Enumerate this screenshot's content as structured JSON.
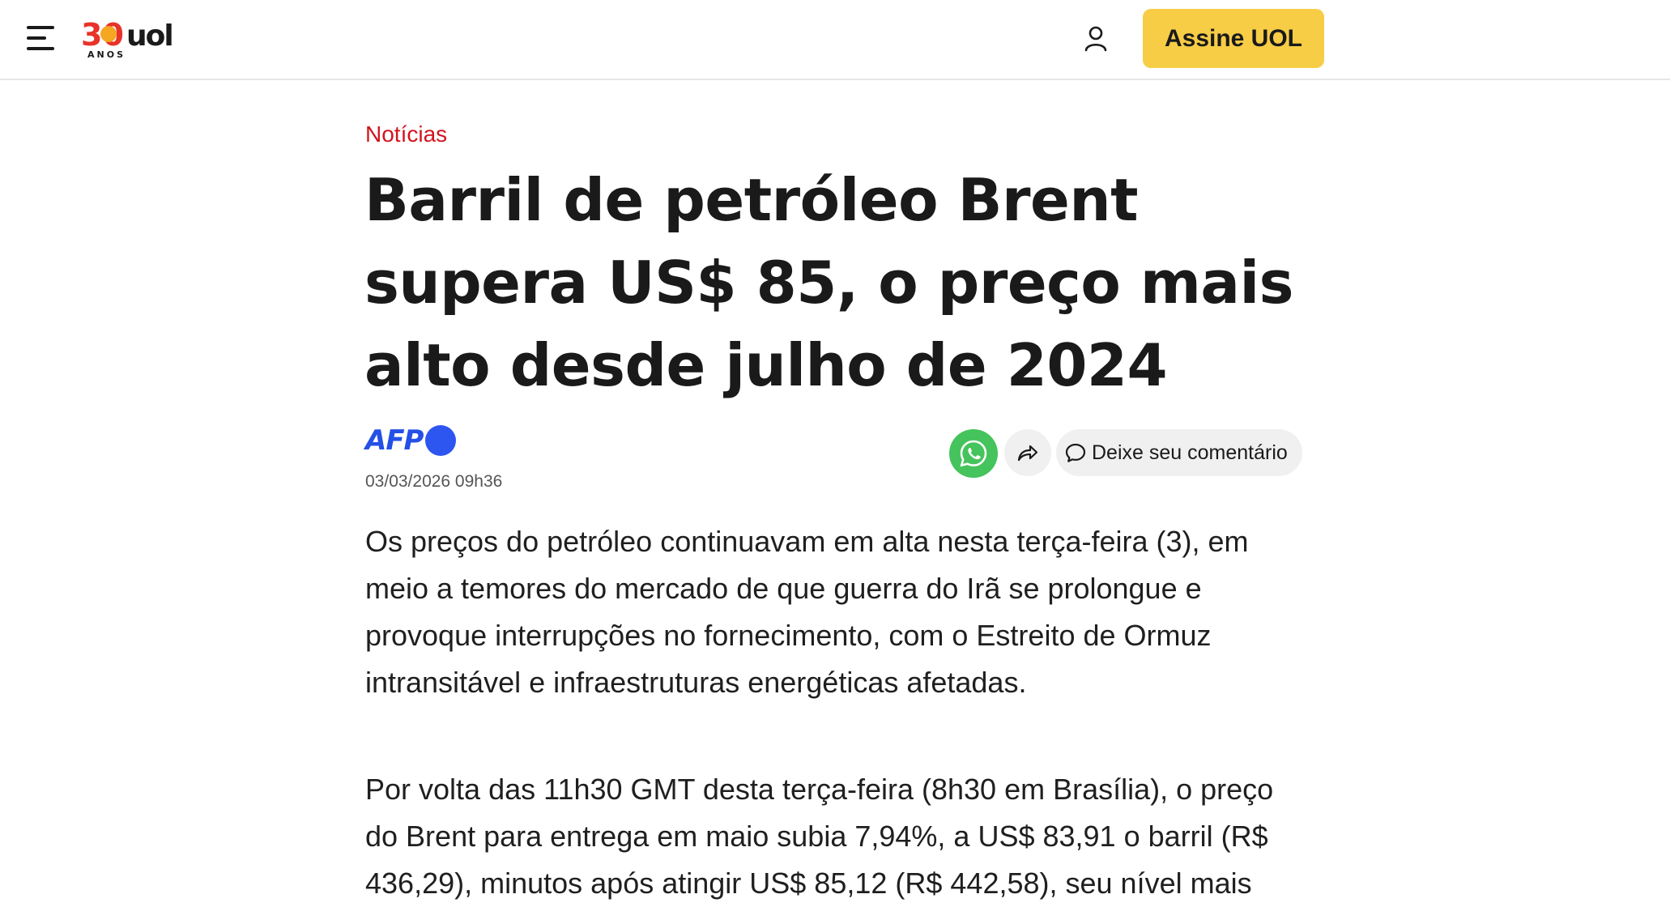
{
  "header": {
    "menu_icon": "hamburger-menu-icon",
    "logo_anos": "ANOS",
    "logo_number": "30",
    "logo_brand": "uol",
    "user_icon": "user-icon",
    "subscribe_label": "Assine UOL",
    "colors": {
      "subscribe_bg": "#f7cd46",
      "logo_red": "#e8322a"
    }
  },
  "article": {
    "category": "Notícias",
    "headline": "Barril de petróleo Brent supera US$ 85, o preço mais alto desde julho de 2024",
    "source": "AFP",
    "date": "03/03/2026 09h36",
    "share": {
      "whatsapp_icon": "whatsapp-icon",
      "share_icon": "share-arrow-icon",
      "comment_icon": "comment-bubble-icon",
      "comment_label": "Deixe seu comentário"
    },
    "paragraphs": [
      "Os preços do petróleo continuavam em alta nesta terça-feira (3), em meio a temores do mercado de que guerra do Irã se prolongue e provoque interrupções no fornecimento, com o Estreito de Ormuz intransitável e infraestruturas energéticas afetadas.",
      "Por volta das 11h30 GMT desta terça-feira (8h30 em Brasília), o preço do Brent para entrega em maio subia 7,94%, a US$ 83,91 o barril (R$ 436,29), minutos após atingir US$ 85,12 (R$ 442,58), seu nível mais"
    ],
    "colors": {
      "category": "#d2141e",
      "afp_blue": "#2450e6",
      "whatsapp_green": "#45c35c"
    }
  }
}
